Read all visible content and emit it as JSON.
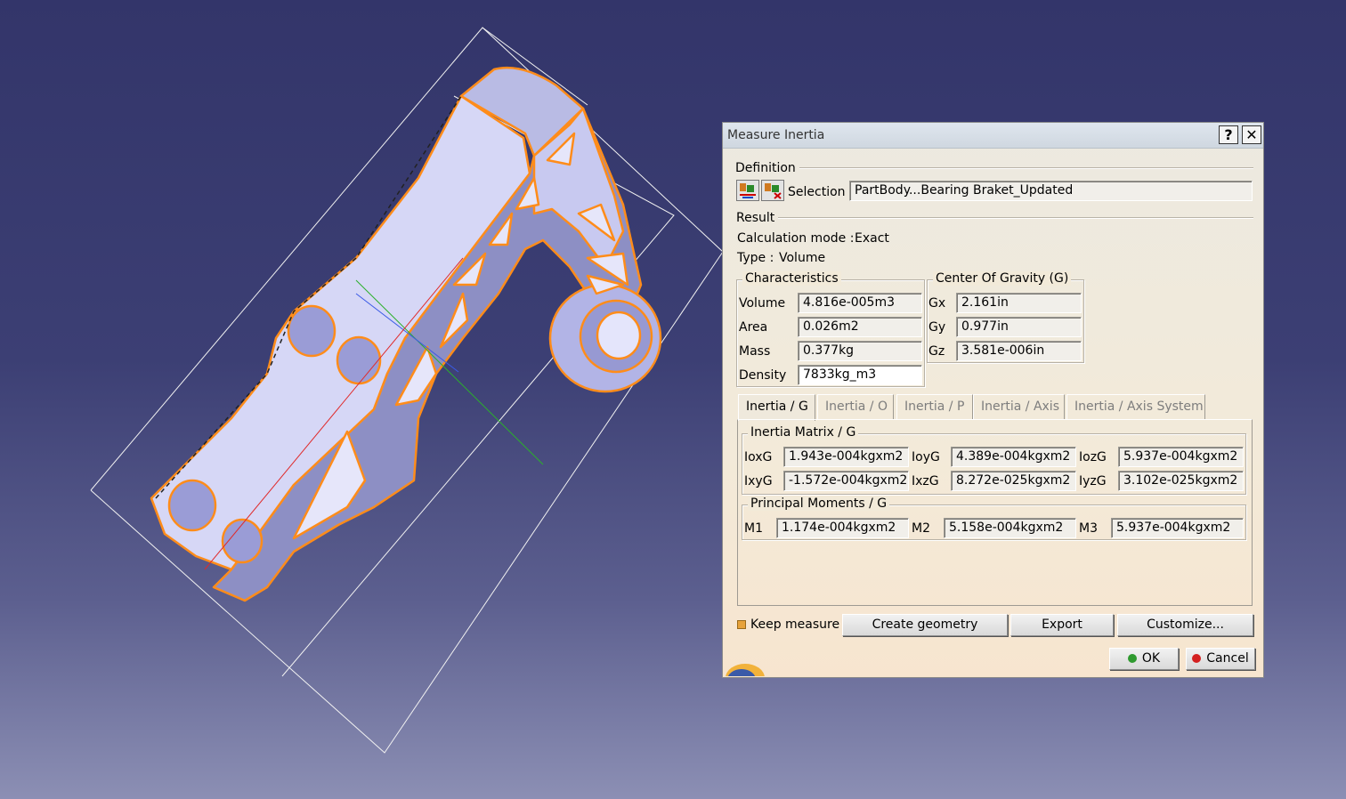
{
  "dialog": {
    "title": "Measure Inertia",
    "help_glyph": "?",
    "close_glyph": "✕",
    "definition": {
      "label": "Definition",
      "selection_label": "Selection :",
      "selection_value": "PartBody...Bearing Braket_Updated"
    },
    "result": {
      "label": "Result",
      "calc_mode_label": "Calculation mode :",
      "calc_mode_value": "Exact",
      "type_label": "Type :",
      "type_value": "Volume"
    },
    "characteristics": {
      "title": "Characteristics",
      "rows": [
        {
          "label": "Volume",
          "value": "4.816e-005m3"
        },
        {
          "label": "Area",
          "value": "0.026m2"
        },
        {
          "label": "Mass",
          "value": "0.377kg"
        },
        {
          "label": "Density",
          "value": "7833kg_m3"
        }
      ]
    },
    "cog": {
      "title": "Center Of Gravity (G)",
      "rows": [
        {
          "label": "Gx",
          "value": "2.161in"
        },
        {
          "label": "Gy",
          "value": "0.977in"
        },
        {
          "label": "Gz",
          "value": "3.581e-006in"
        }
      ]
    },
    "tabs": [
      {
        "label": "Inertia / G",
        "active": true
      },
      {
        "label": "Inertia / O",
        "active": false
      },
      {
        "label": "Inertia / P",
        "active": false
      },
      {
        "label": "Inertia / Axis",
        "active": false
      },
      {
        "label": "Inertia / Axis System",
        "active": false
      }
    ],
    "inertia_matrix": {
      "title": "Inertia Matrix / G",
      "row1": [
        {
          "label": "IoxG",
          "value": "1.943e-004kgxm2"
        },
        {
          "label": "IoyG",
          "value": "4.389e-004kgxm2"
        },
        {
          "label": "IozG",
          "value": "5.937e-004kgxm2"
        }
      ],
      "row2": [
        {
          "label": "IxyG",
          "value": "-1.572e-004kgxm2"
        },
        {
          "label": "IxzG",
          "value": "8.272e-025kgxm2"
        },
        {
          "label": "IyzG",
          "value": "3.102e-025kgxm2"
        }
      ]
    },
    "principal_moments": {
      "title": "Principal Moments / G",
      "row": [
        {
          "label": "M1",
          "value": "1.174e-004kgxm2"
        },
        {
          "label": "M2",
          "value": "5.158e-004kgxm2"
        },
        {
          "label": "M3",
          "value": "5.937e-004kgxm2"
        }
      ]
    },
    "keep_measure_label": "Keep measure",
    "buttons": {
      "create_geometry": "Create geometry",
      "export": "Export",
      "customize": "Customize...",
      "ok": "OK",
      "cancel": "Cancel"
    },
    "colors": {
      "ok_dot": "#2f9a2f",
      "cancel_dot": "#d42020",
      "highlight": "#ff8c1a"
    }
  }
}
